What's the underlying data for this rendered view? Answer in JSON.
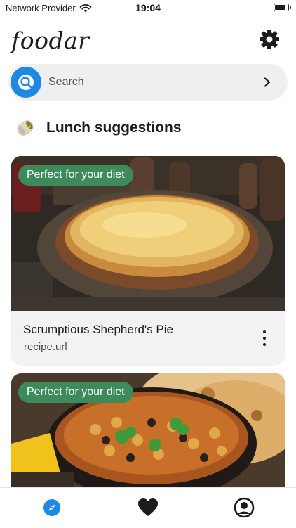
{
  "status_bar": {
    "carrier": "Network Provider",
    "time": "19:04",
    "battery_level": 0.9
  },
  "header": {
    "logo": "foodar",
    "settings_icon": "gear-icon"
  },
  "search": {
    "placeholder": "Search",
    "icon": "search-icon",
    "chevron": "chevron-right-icon"
  },
  "section": {
    "icon": "burrito-icon",
    "title": "Lunch suggestions"
  },
  "cards": [
    {
      "badge": "Perfect for your diet",
      "title": "Scrumptious Shepherd's Pie",
      "url": "recipe.url",
      "image": "shepherds-pie-photo"
    },
    {
      "badge": "Perfect for your diet",
      "title": "",
      "url": "",
      "image": "chickpea-curry-photo"
    }
  ],
  "tab_bar": {
    "tabs": [
      "compass-icon",
      "heart-icon",
      "profile-icon"
    ],
    "active": 0
  },
  "colors": {
    "accent": "#1e88e5",
    "badge": "#3d8b5a",
    "search_bg": "#efeff1",
    "card_bg": "#f2f2f4"
  }
}
